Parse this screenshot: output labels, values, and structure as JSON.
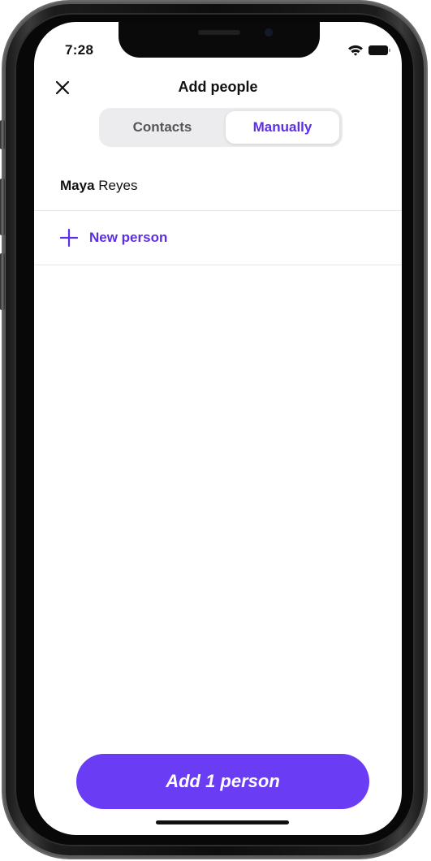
{
  "status_bar": {
    "time": "7:28",
    "icons": [
      "wifi-icon",
      "battery-icon"
    ]
  },
  "header": {
    "close_icon": "close-icon",
    "title": "Add people"
  },
  "segmented_control": {
    "tabs": [
      {
        "label": "Contacts",
        "selected": false
      },
      {
        "label": "Manually",
        "selected": true
      }
    ]
  },
  "people": [
    {
      "first_name": "Maya",
      "last_name": "Reyes"
    }
  ],
  "new_person": {
    "icon": "plus-icon",
    "label": "New person"
  },
  "primary_action": {
    "label": "Add 1 person"
  },
  "colors": {
    "accent": "#5b2ee8",
    "button": "#6a3df5"
  }
}
